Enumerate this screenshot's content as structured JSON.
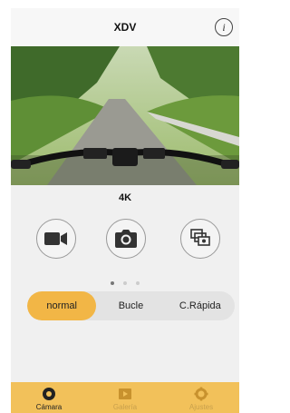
{
  "header": {
    "title": "XDV",
    "info_label": "i"
  },
  "camera": {
    "resolution": "4K"
  },
  "modes": [
    {
      "icon": "video-camera-icon"
    },
    {
      "icon": "photo-camera-icon"
    },
    {
      "icon": "burst-photo-icon"
    }
  ],
  "pager": {
    "count": 3,
    "active": 0
  },
  "segment": {
    "options": [
      "normal",
      "Bucle",
      "C.Rápida"
    ],
    "selected": 0
  },
  "tabbar": {
    "items": [
      {
        "label": "Cámara",
        "icon": "camera-tab-icon",
        "active": true
      },
      {
        "label": "Galería",
        "icon": "gallery-tab-icon",
        "active": false
      },
      {
        "label": "Ajustes",
        "icon": "settings-gear-icon",
        "active": false
      }
    ]
  },
  "colors": {
    "accent": "#f2b646",
    "tabbar": "#f2c15a"
  }
}
